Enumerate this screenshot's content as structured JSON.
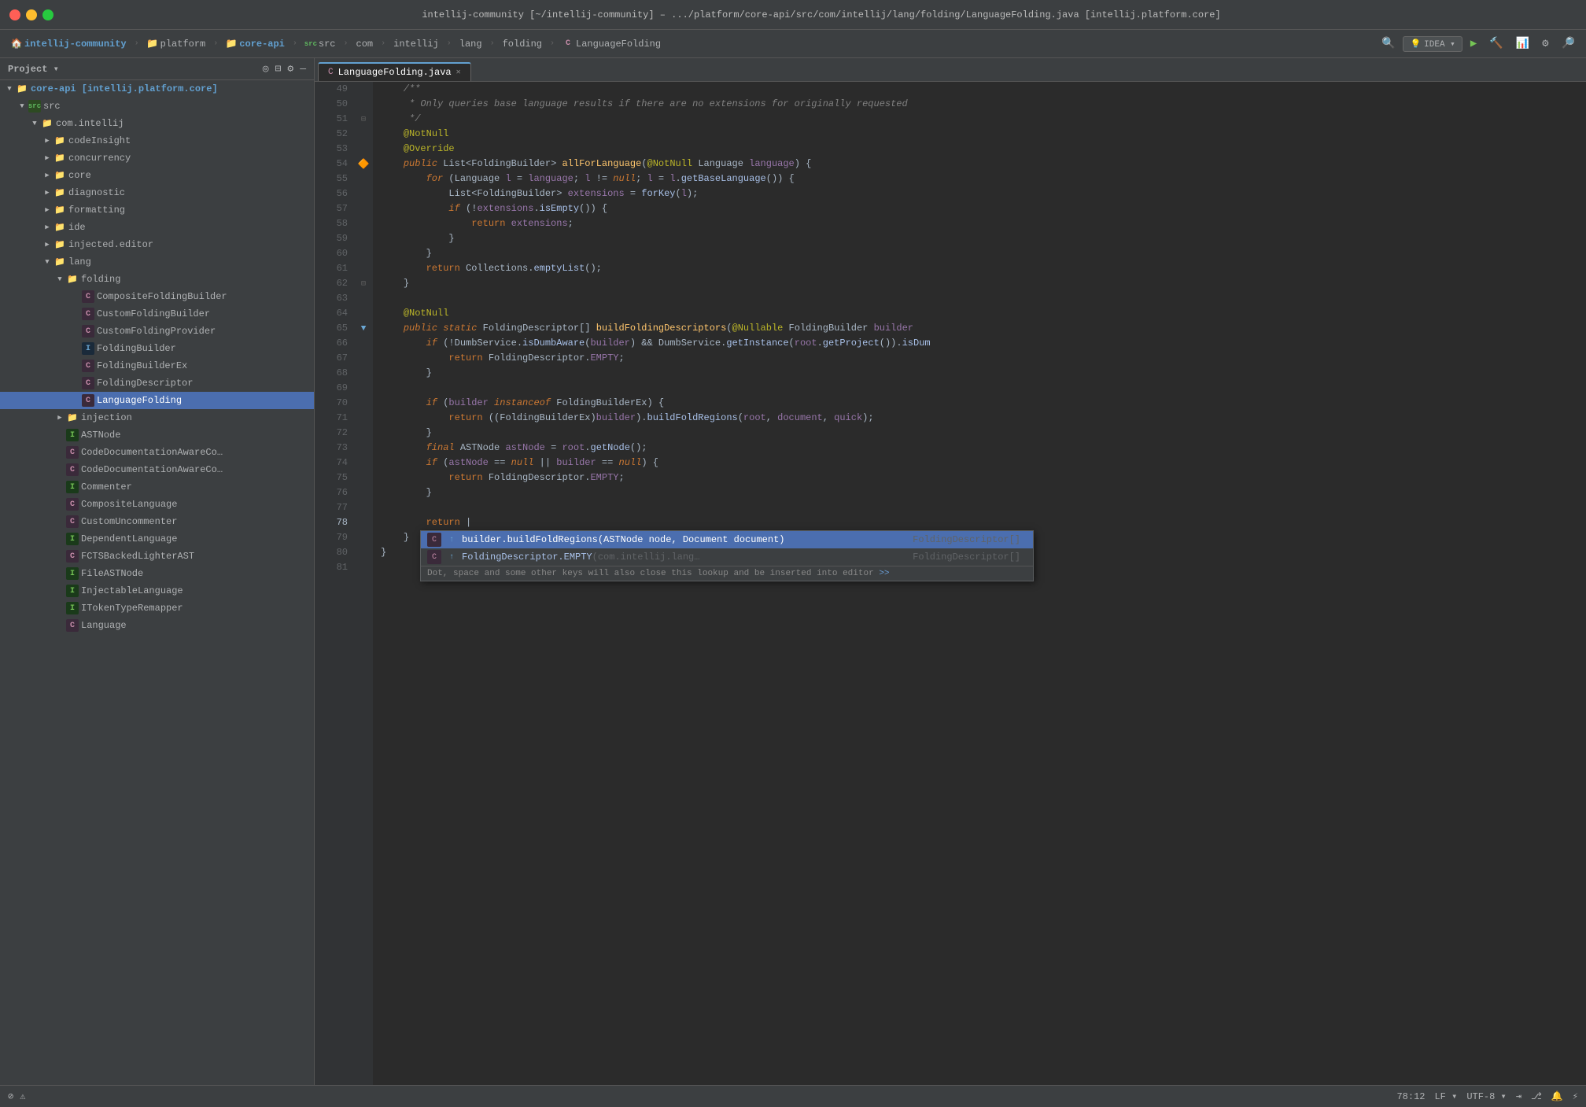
{
  "window": {
    "title": "intellij-community [~/intellij-community] – .../platform/core-api/src/com/intellij/lang/folding/LanguageFolding.java [intellij.platform.core]"
  },
  "nav": {
    "items": [
      {
        "label": "intellij-community",
        "icon": "🏠"
      },
      {
        "label": "platform"
      },
      {
        "label": "core-api"
      },
      {
        "label": "src"
      },
      {
        "label": "com"
      },
      {
        "label": "intellij"
      },
      {
        "label": "lang"
      },
      {
        "label": "folding"
      },
      {
        "label": "LanguageFolding"
      }
    ],
    "run_btn": "▶",
    "idea_label": "IDEA ▾"
  },
  "sidebar": {
    "title": "Project ▾",
    "root": "core-api [intellij.platform.core]",
    "items": [
      {
        "id": "src",
        "label": "src",
        "type": "src",
        "indent": 1,
        "expanded": true
      },
      {
        "id": "com.intellij",
        "label": "com.intellij",
        "type": "folder",
        "indent": 2,
        "expanded": true
      },
      {
        "id": "codeInsight",
        "label": "codeInsight",
        "type": "folder",
        "indent": 3,
        "expanded": false
      },
      {
        "id": "concurrency",
        "label": "concurrency",
        "type": "folder",
        "indent": 3,
        "expanded": false
      },
      {
        "id": "core",
        "label": "core",
        "type": "folder",
        "indent": 3,
        "expanded": false
      },
      {
        "id": "diagnostic",
        "label": "diagnostic",
        "type": "folder",
        "indent": 3,
        "expanded": false
      },
      {
        "id": "formatting",
        "label": "formatting",
        "type": "folder",
        "indent": 3,
        "expanded": false
      },
      {
        "id": "ide",
        "label": "ide",
        "type": "folder",
        "indent": 3,
        "expanded": false
      },
      {
        "id": "injected.editor",
        "label": "injected.editor",
        "type": "folder",
        "indent": 3,
        "expanded": false
      },
      {
        "id": "lang",
        "label": "lang",
        "type": "folder",
        "indent": 3,
        "expanded": true
      },
      {
        "id": "folding",
        "label": "folding",
        "type": "folder",
        "indent": 4,
        "expanded": true
      },
      {
        "id": "CompositeFoldingBuilder",
        "label": "CompositeFoldingBuilder",
        "type": "class",
        "indent": 5
      },
      {
        "id": "CustomFoldingBuilder",
        "label": "CustomFoldingBuilder",
        "type": "class",
        "indent": 5
      },
      {
        "id": "CustomFoldingProvider",
        "label": "CustomFoldingProvider",
        "type": "class",
        "indent": 5
      },
      {
        "id": "FoldingBuilder",
        "label": "FoldingBuilder",
        "type": "interface",
        "indent": 5
      },
      {
        "id": "FoldingBuilderEx",
        "label": "FoldingBuilderEx",
        "type": "class",
        "indent": 5
      },
      {
        "id": "FoldingDescriptor",
        "label": "FoldingDescriptor",
        "type": "class",
        "indent": 5
      },
      {
        "id": "LanguageFolding",
        "label": "LanguageFolding",
        "type": "class",
        "indent": 5,
        "selected": true
      },
      {
        "id": "injection",
        "label": "injection",
        "type": "folder",
        "indent": 3,
        "expanded": false
      },
      {
        "id": "ASTNode",
        "label": "ASTNode",
        "type": "interface",
        "indent": 4
      },
      {
        "id": "CodeDocumentationAwareCo1",
        "label": "CodeDocumentationAwareCo…",
        "type": "class",
        "indent": 4
      },
      {
        "id": "CodeDocumentationAwareCo2",
        "label": "CodeDocumentationAwareCo…",
        "type": "class",
        "indent": 4
      },
      {
        "id": "Commenter",
        "label": "Commenter",
        "type": "interface",
        "indent": 4
      },
      {
        "id": "CompositeLanguage",
        "label": "CompositeLanguage",
        "type": "class",
        "indent": 4
      },
      {
        "id": "CustomUncommenter",
        "label": "CustomUncommenter",
        "type": "class",
        "indent": 4
      },
      {
        "id": "DependentLanguage",
        "label": "DependentLanguage",
        "type": "interface",
        "indent": 4
      },
      {
        "id": "FCTSBackedLighterAST",
        "label": "FCTSBackedLighterAST",
        "type": "class",
        "indent": 4
      },
      {
        "id": "FileASTNode",
        "label": "FileASTNode",
        "type": "interface",
        "indent": 4
      },
      {
        "id": "InjectableLanguage",
        "label": "InjectableLanguage",
        "type": "interface",
        "indent": 4
      },
      {
        "id": "ITokenTypeRemapper",
        "label": "ITokenTypeRemapper",
        "type": "interface",
        "indent": 4
      },
      {
        "id": "Language",
        "label": "Language",
        "type": "class",
        "indent": 4
      }
    ]
  },
  "tab": {
    "filename": "LanguageFolding.java",
    "modified": false
  },
  "code": {
    "lines": [
      {
        "num": 49,
        "content": "    /**",
        "gutter": ""
      },
      {
        "num": 50,
        "content": "     * Only queries base language results if there are no extensions for originally requested",
        "gutter": ""
      },
      {
        "num": 51,
        "content": "     */",
        "gutter": "fold"
      },
      {
        "num": 52,
        "content": "    @NotNull",
        "gutter": ""
      },
      {
        "num": 53,
        "content": "    @Override",
        "gutter": ""
      },
      {
        "num": 54,
        "content": "    public List<FoldingBuilder> allForLanguage(@NotNull Language language) {",
        "gutter": "run"
      },
      {
        "num": 55,
        "content": "        for (Language l = language; l != null; l = l.getBaseLanguage()) {",
        "gutter": ""
      },
      {
        "num": 56,
        "content": "            List<FoldingBuilder> extensions = forKey(l);",
        "gutter": ""
      },
      {
        "num": 57,
        "content": "            if (!extensions.isEmpty()) {",
        "gutter": ""
      },
      {
        "num": 58,
        "content": "                return extensions;",
        "gutter": ""
      },
      {
        "num": 59,
        "content": "            }",
        "gutter": ""
      },
      {
        "num": 60,
        "content": "        }",
        "gutter": ""
      },
      {
        "num": 61,
        "content": "        return Collections.emptyList();",
        "gutter": ""
      },
      {
        "num": 62,
        "content": "    }",
        "gutter": "fold"
      },
      {
        "num": 63,
        "content": "",
        "gutter": ""
      },
      {
        "num": 64,
        "content": "    @NotNull",
        "gutter": ""
      },
      {
        "num": 65,
        "content": "    public static FoldingDescriptor[] buildFoldingDescriptors(@Nullable FoldingBuilder builder",
        "gutter": "impl"
      },
      {
        "num": 66,
        "content": "        if (!DumbService.isDumbAware(builder) && DumbService.getInstance(root.getProject()).isDum",
        "gutter": ""
      },
      {
        "num": 67,
        "content": "            return FoldingDescriptor.EMPTY;",
        "gutter": ""
      },
      {
        "num": 68,
        "content": "        }",
        "gutter": ""
      },
      {
        "num": 69,
        "content": "",
        "gutter": ""
      },
      {
        "num": 70,
        "content": "        if (builder instanceof FoldingBuilderEx) {",
        "gutter": ""
      },
      {
        "num": 71,
        "content": "            return ((FoldingBuilderEx)builder).buildFoldRegions(root, document, quick);",
        "gutter": ""
      },
      {
        "num": 72,
        "content": "        }",
        "gutter": ""
      },
      {
        "num": 73,
        "content": "        final ASTNode astNode = root.getNode();",
        "gutter": ""
      },
      {
        "num": 74,
        "content": "        if (astNode == null || builder == null) {",
        "gutter": ""
      },
      {
        "num": 75,
        "content": "            return FoldingDescriptor.EMPTY;",
        "gutter": ""
      },
      {
        "num": 76,
        "content": "        }",
        "gutter": ""
      },
      {
        "num": 77,
        "content": "",
        "gutter": ""
      },
      {
        "num": 78,
        "content": "        return |",
        "gutter": ""
      },
      {
        "num": 79,
        "content": "    }",
        "gutter": ""
      },
      {
        "num": 80,
        "content": "}",
        "gutter": ""
      },
      {
        "num": 81,
        "content": "",
        "gutter": ""
      }
    ]
  },
  "autocomplete": {
    "items": [
      {
        "icon": "◆",
        "icon_color": "#c88daa",
        "secondary_icon": "↑",
        "secondary_color": "#6aa7d4",
        "name": "builder.buildFoldRegions(ASTNode node, Document document)",
        "return_type": "FoldingDescriptor[]",
        "selected": true
      },
      {
        "icon": "◆",
        "icon_color": "#c88daa",
        "secondary_icon": "↑",
        "secondary_color": "#6aa7d4",
        "name": "FoldingDescriptor.EMPTY",
        "params": "(com.intellij.lang…",
        "return_type": "FoldingDescriptor[]",
        "selected": false
      }
    ],
    "hint": "Dot, space and some other keys will also close this lookup and be inserted into editor",
    "hint_link": ">>"
  },
  "statusbar": {
    "position": "78:12",
    "lf": "LF ▾",
    "encoding": "UTF-8 ▾",
    "indent": "⇥",
    "git": "⎇",
    "notifications": "🔔",
    "power": "⚡"
  },
  "colors": {
    "accent": "#4b6eaf",
    "selected_tab": "#2b2b2b",
    "sidebar_bg": "#3c3f41",
    "editor_bg": "#2b2b2b",
    "gutter_bg": "#313335",
    "autocomplete_selected": "#4b6eaf"
  }
}
